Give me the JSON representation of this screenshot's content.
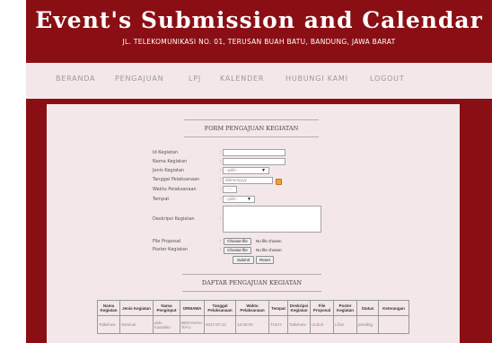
{
  "header": {
    "title": "Event's Submission and Calendar",
    "address": "JL. TELEKOMUNIKASI NO. 01, TERUSAN BUAH BATU, BANDUNG, JAWA BARAT"
  },
  "nav": [
    "BERANDA",
    "PENGAJUAN",
    "LPJ",
    "KALENDER",
    "HUBUNGI KAMI",
    "LOGOUT"
  ],
  "form": {
    "title": "FORM PENGAJUAN KEGIATAN",
    "labels": {
      "id": "Id Kegiatan",
      "nama": "Nama Kegiatan",
      "jenis": "Jenis Kegiatan",
      "tanggal": "Tanggal Pelaksanaan",
      "waktu": "Waktu Pelaksanaan",
      "tempat": "Tempat",
      "deskripsi": "Deskripsi Kegiatan",
      "proposal": "File Proposal",
      "poster": "Poster Kegiatan"
    },
    "colon": ":",
    "jenis_value": "--pilih--",
    "tanggal_placeholder": "dd/mm/yyyy",
    "waktu_value": "--:--",
    "tempat_value": "--pilih--",
    "choose_file": "Choose file",
    "no_file": "No file chosen",
    "submit": "Submit",
    "reset": "Reset"
  },
  "list": {
    "title": "DAFTAR PENGAJUAN KEGIATAN",
    "columns": [
      "Nama Kegiatan",
      "Jenis Kegiatan",
      "Nama Penginput",
      "ORMAWA",
      "Tanggal Pelaksanaan",
      "Waktu Pelaksanaan",
      "Tempat",
      "Deskripsi Kegiatan",
      "File Proposal",
      "Poster Kegiatan",
      "Status",
      "Keterangan"
    ],
    "rows": [
      [
        "Talkshow",
        "Seminar",
        "aldo Kandako",
        "BEM Kema Tel-U",
        "2017-07-12",
        "12:00:00",
        "TUCH",
        "Talkshow",
        "Unduh",
        "Lihat",
        "pending",
        ""
      ]
    ]
  }
}
